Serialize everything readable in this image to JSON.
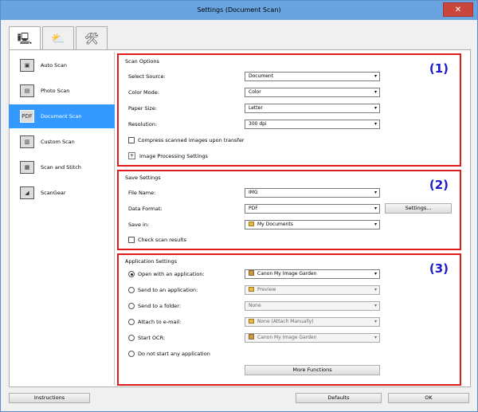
{
  "window": {
    "title": "Settings (Document Scan)",
    "close_glyph": "✕"
  },
  "tabs": [
    {
      "icon": "scanner-computer-icon",
      "glyph": "🖳"
    },
    {
      "icon": "scanner-network-icon",
      "glyph": "⛅"
    },
    {
      "icon": "tools-icon",
      "glyph": "🛠"
    }
  ],
  "sidebar": {
    "items": [
      {
        "label": "Auto Scan",
        "glyph": "▣"
      },
      {
        "label": "Photo Scan",
        "glyph": "▤"
      },
      {
        "label": "Document Scan",
        "glyph": "PDF"
      },
      {
        "label": "Custom Scan",
        "glyph": "▥"
      },
      {
        "label": "Scan and Stitch",
        "glyph": "▦"
      },
      {
        "label": "ScanGear",
        "glyph": "◢"
      }
    ]
  },
  "scan_options": {
    "title": "Scan Options",
    "number": "(1)",
    "source_label": "Select Source:",
    "source_value": "Document",
    "color_label": "Color Mode:",
    "color_value": "Color",
    "paper_label": "Paper Size:",
    "paper_value": "Letter",
    "resolution_label": "Resolution:",
    "resolution_value": "300 dpi",
    "compress_label": "Compress scanned images upon transfer",
    "image_processing_label": "Image Processing Settings",
    "expander_glyph": "+"
  },
  "save_settings": {
    "title": "Save Settings",
    "number": "(2)",
    "file_name_label": "File Name:",
    "file_name_value": "IMG",
    "format_label": "Data Format:",
    "format_value": "PDF",
    "settings_button": "Settings...",
    "save_in_label": "Save in:",
    "save_in_value": "My Documents",
    "check_results_label": "Check scan results"
  },
  "application_settings": {
    "title": "Application Settings",
    "number": "(3)",
    "open_app_label": "Open with an application:",
    "open_app_value": "Canon My Image Garden",
    "send_app_label": "Send to an application:",
    "send_app_value": "Preview",
    "send_folder_label": "Send to a folder:",
    "send_folder_value": "None",
    "email_label": "Attach to e-mail:",
    "email_value": "None (Attach Manually)",
    "ocr_label": "Start OCR:",
    "ocr_value": "Canon My Image Garden",
    "no_app_label": "Do not start any application",
    "more_functions_button": "More Functions"
  },
  "footer": {
    "instructions_button": "Instructions",
    "defaults_button": "Defaults",
    "ok_button": "OK"
  },
  "dropdown_glyph": "▾",
  "colors": {
    "title_bar": "#69a4e0",
    "highlight": "#3399ff",
    "annotation_border": "#e01b1b",
    "annotation_number": "#1a1acc"
  }
}
